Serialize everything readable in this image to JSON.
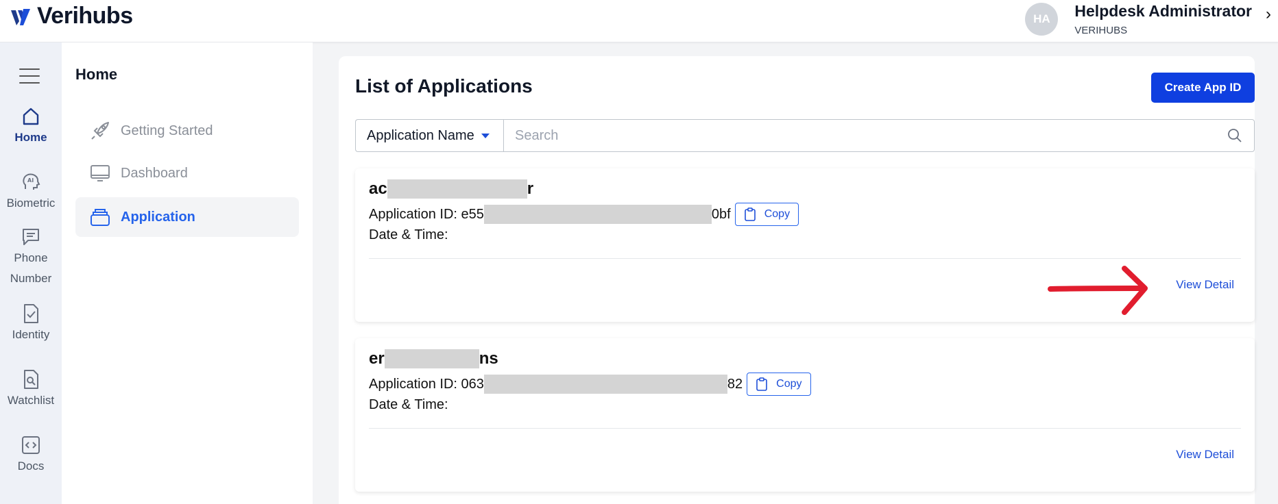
{
  "header": {
    "logo_text": "Verihubs",
    "user": {
      "initials": "HA",
      "name": "Helpdesk Administrator",
      "org": "VERIHUBS"
    }
  },
  "rail": {
    "items": [
      {
        "label": "Home",
        "icon": "home-icon",
        "active": true
      },
      {
        "label": "Biometric",
        "icon": "ai-head-icon"
      },
      {
        "label": "Phone Number",
        "icon": "chat-icon"
      },
      {
        "label": "Identity",
        "icon": "document-check-icon"
      },
      {
        "label": "Watchlist",
        "icon": "document-search-icon"
      },
      {
        "label": "Docs",
        "icon": "code-icon"
      }
    ]
  },
  "subnav": {
    "title": "Home",
    "items": [
      {
        "label": "Getting Started",
        "icon": "rocket-icon"
      },
      {
        "label": "Dashboard",
        "icon": "monitor-icon"
      },
      {
        "label": "Application",
        "icon": "stack-icon",
        "active": true
      }
    ]
  },
  "main": {
    "title": "List of Applications",
    "create_button": "Create App ID",
    "filter": {
      "selected": "Application Name",
      "placeholder": "Search"
    },
    "apps": [
      {
        "name_start": "ac",
        "name_end": "r",
        "id_label": "Application ID:",
        "id_start": "e55",
        "id_end": "0bf",
        "copy": "Copy",
        "date_label": "Date & Time:",
        "view": "View Detail"
      },
      {
        "name_start": "er",
        "name_end": "ns",
        "id_label": "Application ID:",
        "id_start": "063",
        "id_end": "82",
        "copy": "Copy",
        "date_label": "Date & Time:",
        "view": "View Detail"
      }
    ]
  },
  "colors": {
    "primary": "#0f3fe0",
    "link": "#1d4ed8",
    "annotation_arrow": "#e11d2e"
  }
}
